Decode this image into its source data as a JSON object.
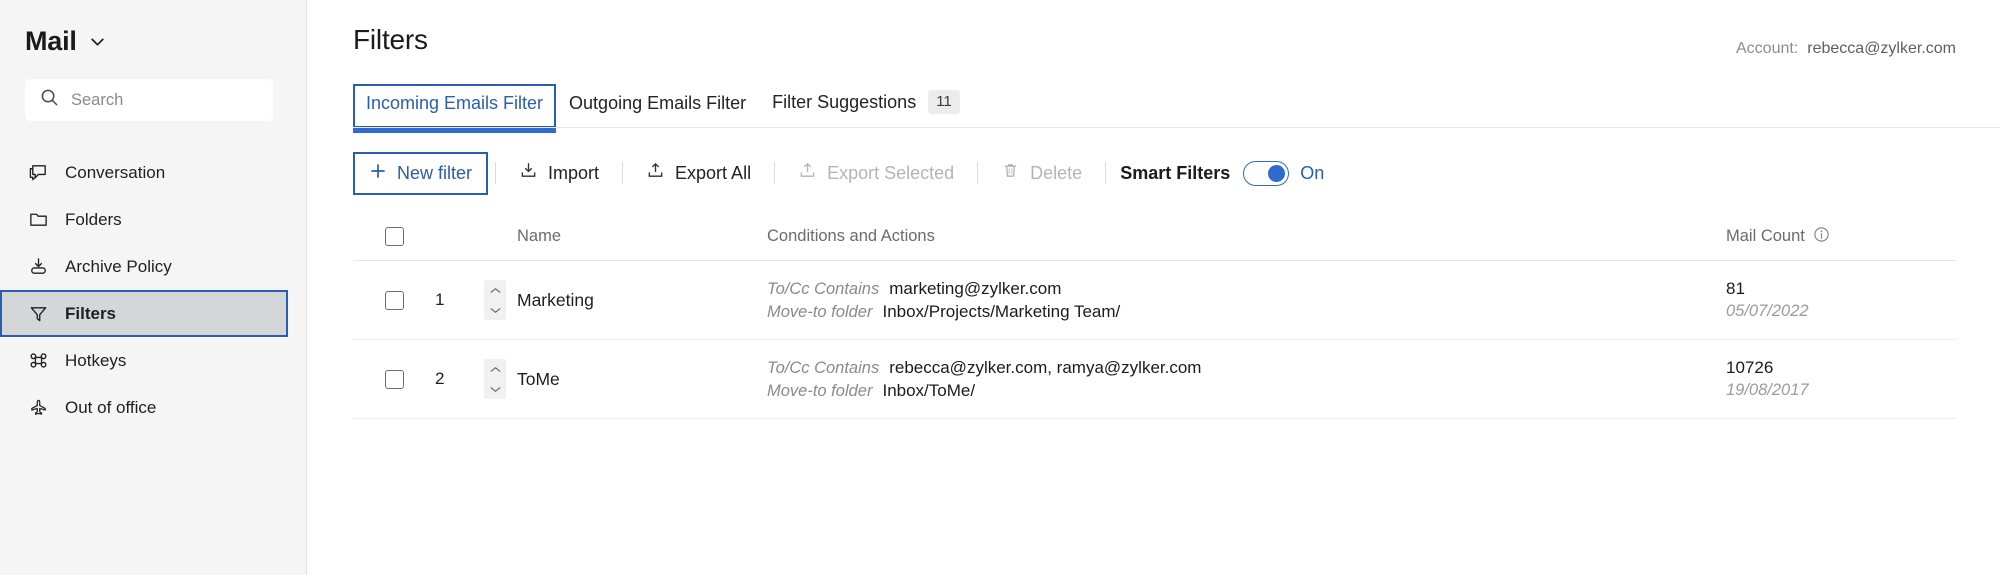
{
  "sidebar": {
    "brand": {
      "title": "Mail",
      "chevron_icon": "chevron-down-icon"
    },
    "search": {
      "placeholder": "Search",
      "icon": "search-icon"
    },
    "items": [
      {
        "label": "Conversation",
        "icon": "conversation-icon",
        "selected": false
      },
      {
        "label": "Folders",
        "icon": "folder-icon",
        "selected": false
      },
      {
        "label": "Archive Policy",
        "icon": "archive-icon",
        "selected": false
      },
      {
        "label": "Filters",
        "icon": "filter-icon",
        "selected": true
      },
      {
        "label": "Hotkeys",
        "icon": "command-icon",
        "selected": false
      },
      {
        "label": "Out of office",
        "icon": "airplane-icon",
        "selected": false
      }
    ]
  },
  "header": {
    "title": "Filters",
    "account_label": "Account:",
    "account_value": "rebecca@zylker.com"
  },
  "tabs": [
    {
      "label": "Incoming Emails Filter",
      "active": true,
      "badge": ""
    },
    {
      "label": "Outgoing Emails Filter",
      "active": false,
      "badge": ""
    },
    {
      "label": "Filter Suggestions",
      "active": false,
      "badge": "11"
    }
  ],
  "toolbar": {
    "new_filter": "New filter",
    "new_filter_icon": "plus-icon",
    "import": "Import",
    "import_icon": "import-icon",
    "export_all": "Export All",
    "export_all_icon": "export-icon",
    "export_selected": "Export Selected",
    "export_selected_icon": "export-icon",
    "delete": "Delete",
    "delete_icon": "trash-icon",
    "smart_filters_label": "Smart Filters",
    "smart_filters_state": "On"
  },
  "table": {
    "headers": {
      "name": "Name",
      "conditions": "Conditions and Actions",
      "mail_count": "Mail Count",
      "mail_count_icon": "info-icon"
    },
    "rows": [
      {
        "index": "1",
        "name": "Marketing",
        "conditions": [
          {
            "key": "To/Cc Contains",
            "value": "marketing@zylker.com"
          },
          {
            "key": "Move-to folder",
            "value": "Inbox/Projects/Marketing Team/"
          }
        ],
        "count": "81",
        "date": "05/07/2022"
      },
      {
        "index": "2",
        "name": "ToMe",
        "conditions": [
          {
            "key": "To/Cc Contains",
            "value": "rebecca@zylker.com, ramya@zylker.com"
          },
          {
            "key": "Move-to folder",
            "value": "Inbox/ToMe/"
          }
        ],
        "count": "10726",
        "date": "19/08/2017"
      }
    ]
  },
  "colors": {
    "accent": "#2a5db0",
    "toggle_on": "#2f6ad0",
    "sidebar_bg": "#f5f5f5",
    "selected_bg": "#d4d6d8"
  }
}
